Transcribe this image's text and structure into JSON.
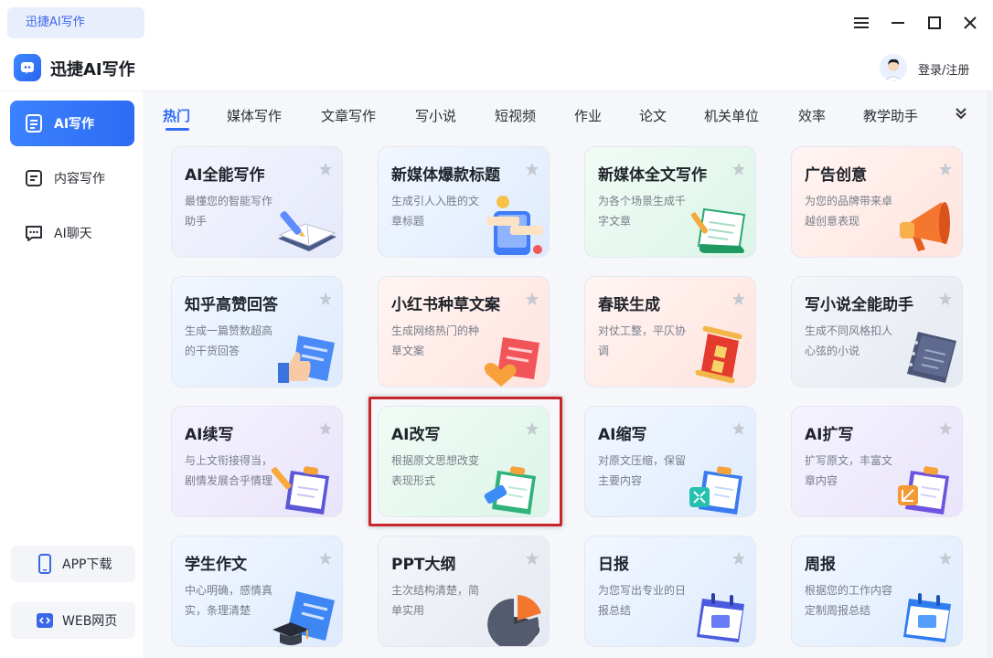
{
  "window": {
    "tab_label": "迅捷AI写作"
  },
  "header": {
    "app_name": "迅捷AI写作",
    "login_label": "登录/注册"
  },
  "sidebar": {
    "items": [
      {
        "label": "AI写作",
        "icon": "book-icon",
        "active": true
      },
      {
        "label": "内容写作",
        "icon": "document-icon",
        "active": false
      },
      {
        "label": "AI聊天",
        "icon": "chat-icon",
        "active": false
      }
    ],
    "bottom": [
      {
        "label": "APP下载",
        "icon": "phone-icon"
      },
      {
        "label": "WEB网页",
        "icon": "web-code-icon"
      }
    ]
  },
  "categories": [
    "热门",
    "媒体写作",
    "文章写作",
    "写小说",
    "短视频",
    "作业",
    "论文",
    "机关单位",
    "效率",
    "教学助手"
  ],
  "active_category": "热门",
  "cards": [
    {
      "title": "AI全能写作",
      "desc": "最懂您的智能写作助手",
      "icon": "book-pen-icon"
    },
    {
      "title": "新媒体爆款标题",
      "desc": "生成引人入胜的文章标题",
      "icon": "phone-title-icon"
    },
    {
      "title": "新媒体全文写作",
      "desc": "为各个场景生成千字文章",
      "icon": "scroll-pen-icon"
    },
    {
      "title": "广告创意",
      "desc": "为您的品牌带来卓越创意表现",
      "icon": "megaphone-icon"
    },
    {
      "title": "知乎高赞回答",
      "desc": "生成一篇赞数超高的干货回答",
      "icon": "thumbs-up-icon"
    },
    {
      "title": "小红书种草文案",
      "desc": "生成网络热门的种草文案",
      "icon": "heart-note-icon"
    },
    {
      "title": "春联生成",
      "desc": "对仗工整，平仄协调",
      "icon": "couplet-scroll-icon"
    },
    {
      "title": "写小说全能助手",
      "desc": "生成不同风格扣人心弦的小说",
      "icon": "notebook-icon"
    },
    {
      "title": "AI续写",
      "desc": "与上文衔接得当，剧情发展合乎情理",
      "icon": "clipboard-pen-icon"
    },
    {
      "title": "AI改写",
      "desc": "根据原文思想改变表现形式",
      "icon": "clipboard-eraser-icon"
    },
    {
      "title": "AI缩写",
      "desc": "对原文压缩，保留主要内容",
      "icon": "clipboard-shrink-icon"
    },
    {
      "title": "AI扩写",
      "desc": "扩写原文，丰富文章内容",
      "icon": "clipboard-expand-icon"
    },
    {
      "title": "学生作文",
      "desc": "中心明确，感情真实，条理清楚",
      "icon": "graduation-cap-icon"
    },
    {
      "title": "PPT大纲",
      "desc": "主次结构清楚，简单实用",
      "icon": "pie-chart-icon"
    },
    {
      "title": "日报",
      "desc": "为您写出专业的日报总结",
      "icon": "daily-calendar-icon"
    },
    {
      "title": "周报",
      "desc": "根据您的工作内容定制周报总结",
      "icon": "weekly-calendar-icon"
    }
  ]
}
